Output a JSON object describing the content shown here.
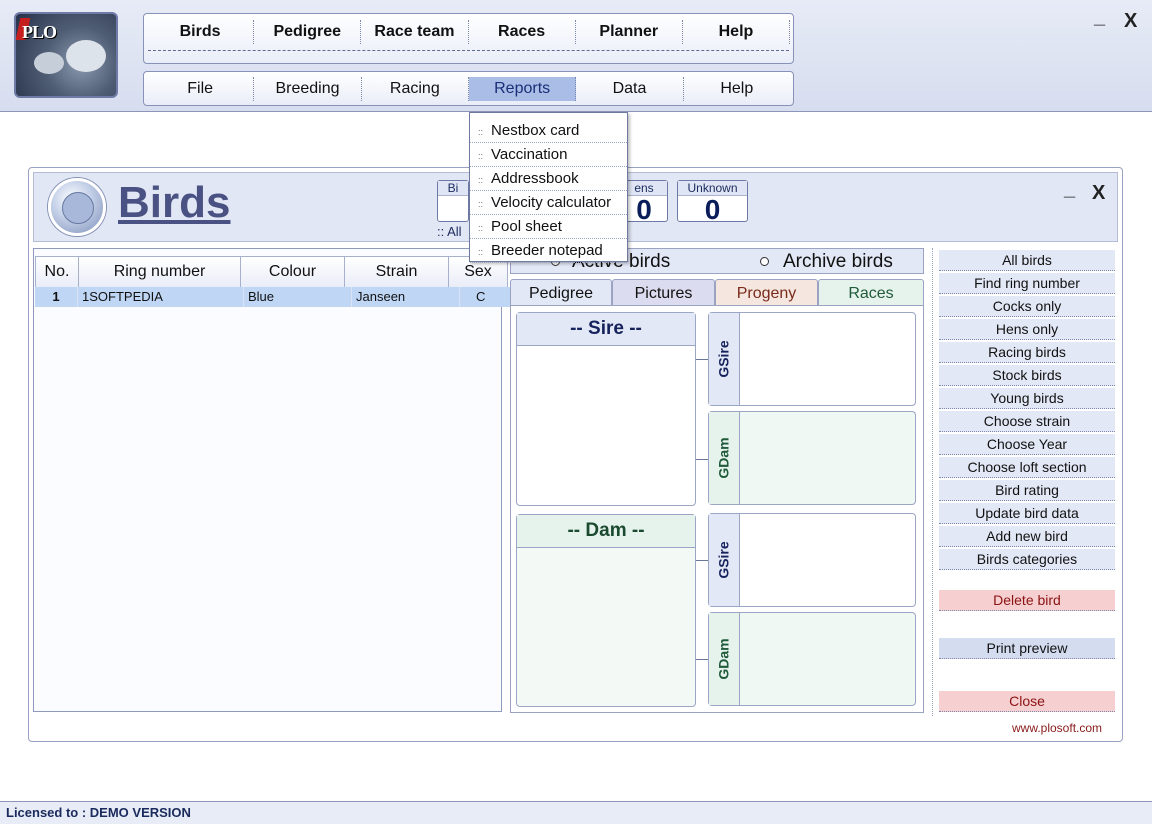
{
  "app": {
    "logo_text": "PLO",
    "main_menu": [
      "Birds",
      "Pedigree",
      "Race team",
      "Races",
      "Planner",
      "Help"
    ],
    "sub_menu": [
      "File",
      "Breeding",
      "Racing",
      "Reports",
      "Data",
      "Help"
    ],
    "active_sub_menu": "Reports",
    "minimize_label": "_",
    "close_label": "X"
  },
  "reports_menu": {
    "items": [
      "Nestbox card",
      "Vaccination",
      "Addressbook",
      "Velocity calculator",
      "Pool sheet",
      "Breeder notepad"
    ]
  },
  "birds_window": {
    "title": "Birds",
    "counters": [
      {
        "label": "Bi",
        "value": ""
      },
      {
        "label": "ens",
        "value": "0"
      },
      {
        "label": "Unknown",
        "value": "0"
      }
    ],
    "all_label": ":: All",
    "minimize_label": "_",
    "close_label": "X"
  },
  "bird_table": {
    "columns": [
      "No.",
      "Ring number",
      "Colour",
      "Strain",
      "Sex"
    ],
    "rows": [
      {
        "no": "1",
        "ring": "1SOFTPEDIA",
        "colour": "Blue",
        "strain": "Janseen",
        "sex": "C"
      }
    ]
  },
  "filter": {
    "active_label": "Active birds",
    "archive_label": "Archive birds"
  },
  "tabs": [
    "Pedigree",
    "Pictures",
    "Progeny",
    "Races"
  ],
  "pedigree": {
    "sire_label": "-- Sire --",
    "dam_label": "-- Dam --",
    "gsire_label": "GSire",
    "gdam_label": "GDam"
  },
  "actions": {
    "buttons": [
      "All birds",
      "Find ring number",
      "Cocks only",
      "Hens only",
      "Racing birds",
      "Stock birds",
      "Young birds",
      "Choose strain",
      "Choose Year",
      "Choose loft section",
      "Bird rating",
      "Update bird data",
      "Add new bird",
      "Birds categories"
    ],
    "delete_label": "Delete bird",
    "print_label": "Print preview",
    "close_label": "Close"
  },
  "footer": {
    "url": "www.plosoft.com",
    "license": "Licensed to : DEMO VERSION"
  },
  "colors": {
    "accent": "#4a5283",
    "active_menu": "#a9bde6",
    "row_highlight": "#bfd6f5",
    "danger": "#f6cfd0"
  }
}
